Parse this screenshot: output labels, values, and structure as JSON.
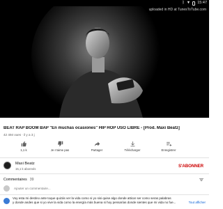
{
  "status_bar": {
    "time": "15:47",
    "icons": [
      "bluetooth-icon",
      "wifi-icon",
      "battery-icon"
    ]
  },
  "video": {
    "watermark": "uploaded in HD at TunesToTube.com"
  },
  "title": "BEAT RAP BOOM BAP \"En muchas ocasiones\" HIP HOP USO LIBRE  -  [Prod. Maxi Beatz]",
  "meta": "42 494 vues · il y a 3 j",
  "actions": [
    {
      "label": "1,1 k",
      "icon": "thumbs-up-icon"
    },
    {
      "label": "Je n'aime pas",
      "icon": "thumbs-down-icon"
    },
    {
      "label": "Partager",
      "icon": "share-icon"
    },
    {
      "label": "Télécharger",
      "icon": "download-icon"
    },
    {
      "label": "Enregistrer",
      "icon": "save-icon"
    }
  ],
  "channel": {
    "name": "Maxi Beatz",
    "subscribers": "15,1 k abonnés",
    "subscribe_label": "S'ABONNER"
  },
  "comments": {
    "header": "Commentaires",
    "count": "39",
    "add_placeholder": "Ajouter un commentaire...",
    "first_comment": {
      "line1": "Voy esta mi destino ante toque quizás ver la vida como si yo sisi quise algo donde atticar ser como seras palabras",
      "line2": "y donde andes que si yo vive la vida como la energía más buena si hoy pensarías donde sientes que mi vida no fue...",
      "read_more": "Tout afficher"
    }
  },
  "colors": {
    "subscribe": "#cc0000",
    "link": "#065fd4"
  }
}
